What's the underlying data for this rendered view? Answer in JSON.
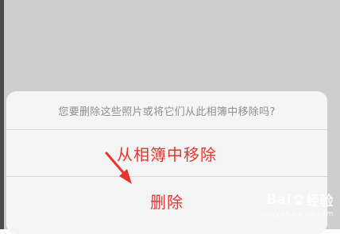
{
  "dialog": {
    "message": "您要删除这些照片或将它们从此相簿中移除吗?",
    "remove_label": "从相簿中移除",
    "delete_label": "删除"
  },
  "annotation": {
    "arrow_color": "#e8342f"
  },
  "watermark": {
    "logo_left": "Bai",
    "logo_right": "经验",
    "url": "jingyan.baidu.com"
  },
  "colors": {
    "accent": "#e8342f",
    "message_text": "#8e8e8e",
    "sheet_bg": "#f5f5f5",
    "backdrop": "#cecece"
  }
}
